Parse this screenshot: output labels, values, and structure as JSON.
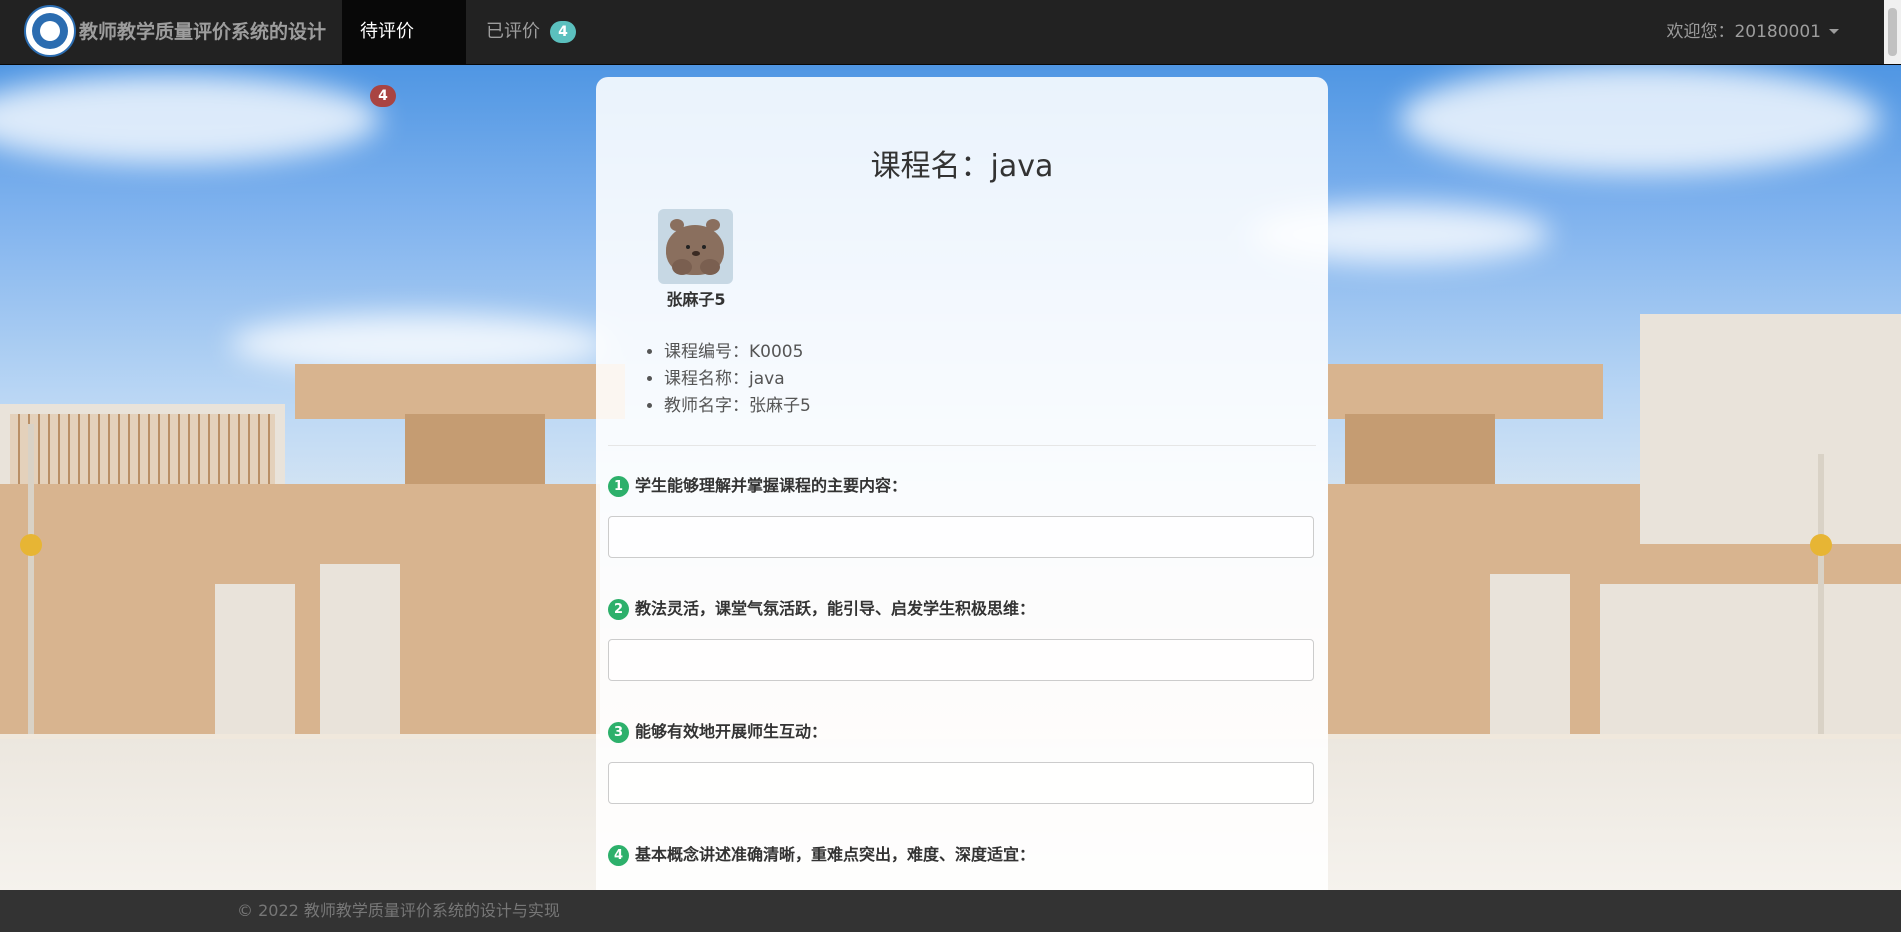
{
  "navbar": {
    "brand": "教师教学质量评价系统的设计",
    "tabs": [
      {
        "label": "待评价",
        "badge": "4",
        "active": true
      },
      {
        "label": "已评价",
        "badge": "4",
        "active": false
      }
    ],
    "welcome": "欢迎您：20180001"
  },
  "course": {
    "title": "课程名：java",
    "teacher_name": "张麻子5",
    "info": [
      "课程编号：K0005",
      "课程名称：java",
      "教师名字：张麻子5"
    ]
  },
  "questions": [
    {
      "num": "1",
      "text": "学生能够理解并掌握课程的主要内容：",
      "value": ""
    },
    {
      "num": "2",
      "text": "教法灵活，课堂气氛活跃，能引导、启发学生积极思维：",
      "value": ""
    },
    {
      "num": "3",
      "text": "能够有效地开展师生互动：",
      "value": ""
    },
    {
      "num": "4",
      "text": "基本概念讲述准确清晰，重难点突出，难度、深度适宜：",
      "value": ""
    }
  ],
  "footer": {
    "copyright": "© 2022 教师教学质量评价系统的设计与实现"
  },
  "colors": {
    "navbar": "#222222",
    "badge_pending": "#a94442",
    "badge_done": "#5bc0be",
    "question_number": "#2db06b",
    "footer": "#333333"
  }
}
